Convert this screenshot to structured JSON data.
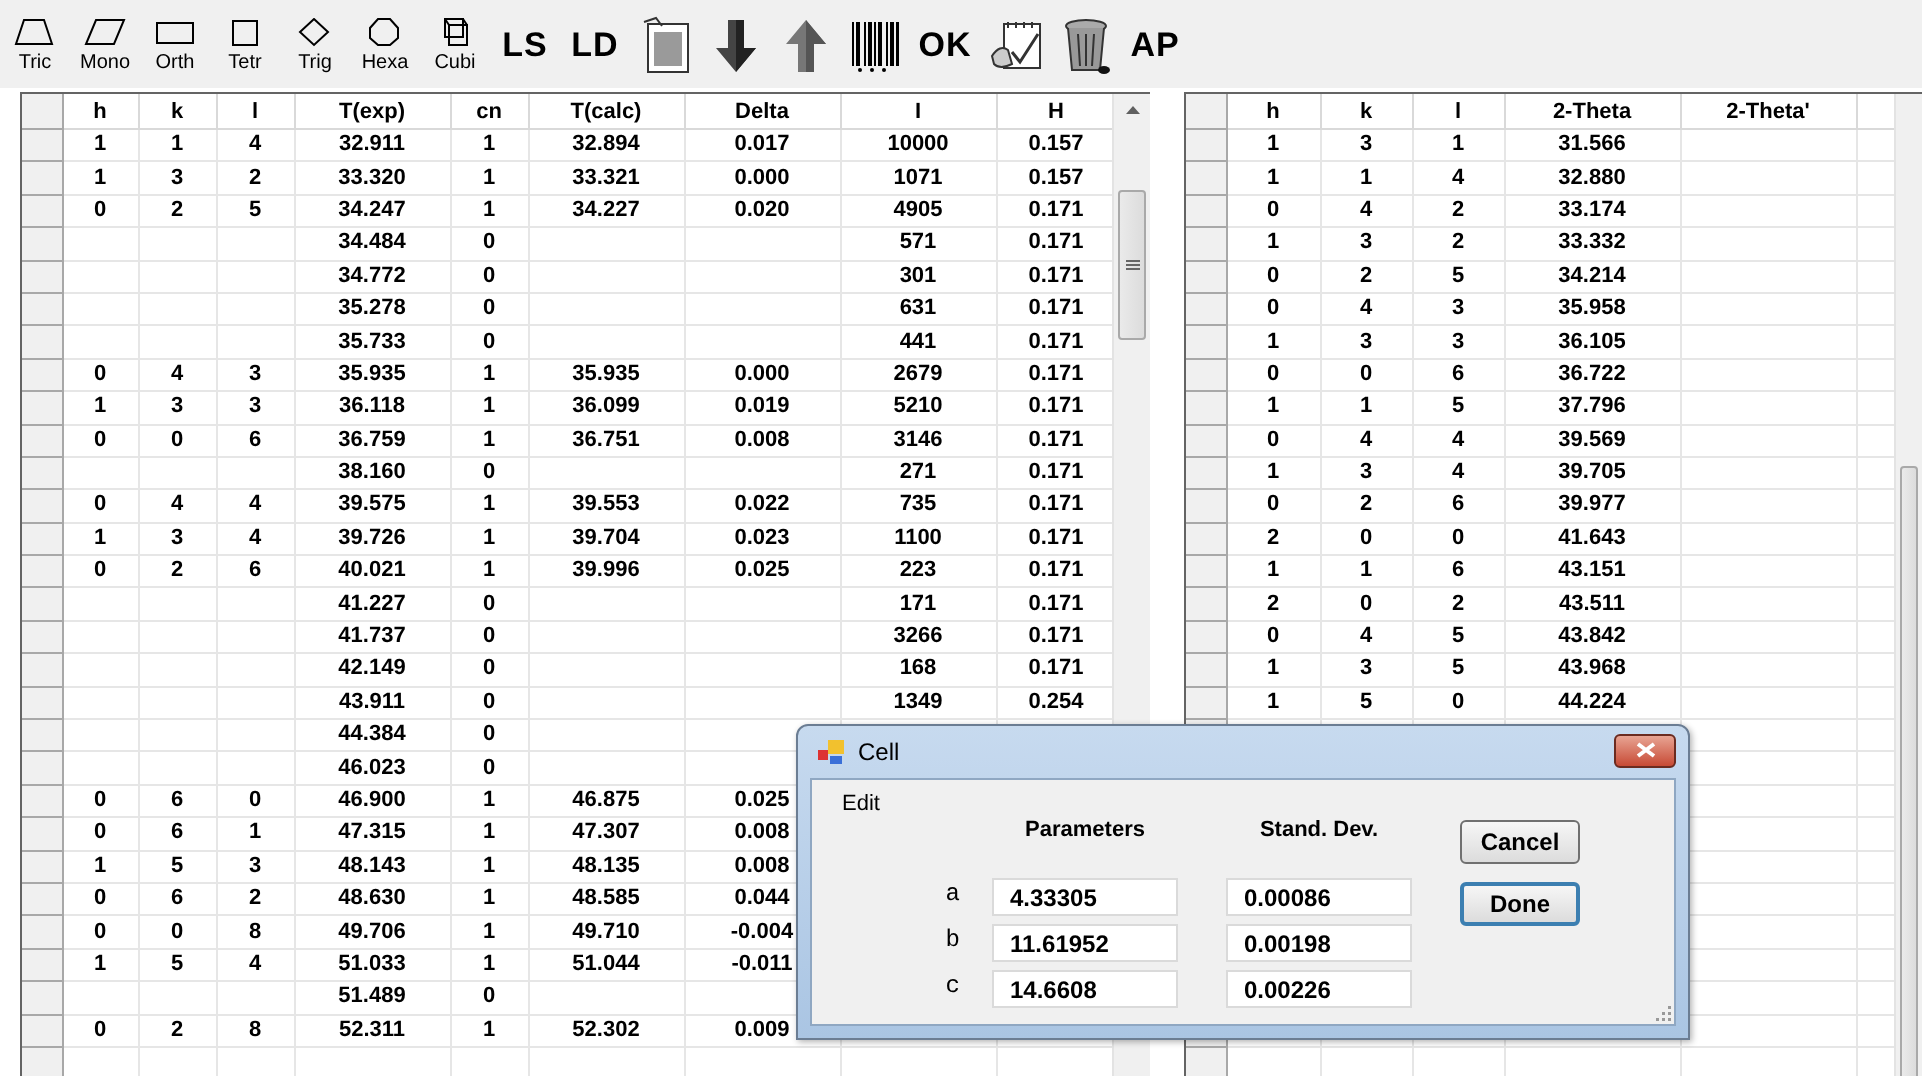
{
  "toolbar": {
    "items": [
      {
        "kind": "shape",
        "label": "Tric"
      },
      {
        "kind": "shape",
        "label": "Mono"
      },
      {
        "kind": "shape",
        "label": "Orth"
      },
      {
        "kind": "shape",
        "label": "Tetr"
      },
      {
        "kind": "shape",
        "label": "Trig"
      },
      {
        "kind": "shape",
        "label": "Hexa"
      },
      {
        "kind": "shape",
        "label": "Cubi"
      },
      {
        "kind": "text",
        "label": "LS"
      },
      {
        "kind": "text",
        "label": "LD"
      },
      {
        "kind": "icon"
      },
      {
        "kind": "icon"
      },
      {
        "kind": "icon"
      },
      {
        "kind": "icon"
      },
      {
        "kind": "text",
        "label": "OK"
      },
      {
        "kind": "icon"
      },
      {
        "kind": "icon"
      },
      {
        "kind": "text",
        "label": "AP"
      }
    ]
  },
  "left_table": {
    "columns": [
      "h",
      "k",
      "l",
      "T(exp)",
      "cn",
      "T(calc)",
      "Delta",
      "I",
      "H"
    ],
    "rows": [
      [
        "1",
        "1",
        "4",
        "32.911",
        "1",
        "32.894",
        "0.017",
        "10000",
        "0.157"
      ],
      [
        "1",
        "3",
        "2",
        "33.320",
        "1",
        "33.321",
        "0.000",
        "1071",
        "0.157"
      ],
      [
        "0",
        "2",
        "5",
        "34.247",
        "1",
        "34.227",
        "0.020",
        "4905",
        "0.171"
      ],
      [
        null,
        null,
        null,
        "34.484",
        "0",
        null,
        null,
        "571",
        "0.171"
      ],
      [
        null,
        null,
        null,
        "34.772",
        "0",
        null,
        null,
        "301",
        "0.171"
      ],
      [
        null,
        null,
        null,
        "35.278",
        "0",
        null,
        null,
        "631",
        "0.171"
      ],
      [
        null,
        null,
        null,
        "35.733",
        "0",
        null,
        null,
        "441",
        "0.171"
      ],
      [
        "0",
        "4",
        "3",
        "35.935",
        "1",
        "35.935",
        "0.000",
        "2679",
        "0.171"
      ],
      [
        "1",
        "3",
        "3",
        "36.118",
        "1",
        "36.099",
        "0.019",
        "5210",
        "0.171"
      ],
      [
        "0",
        "0",
        "6",
        "36.759",
        "1",
        "36.751",
        "0.008",
        "3146",
        "0.171"
      ],
      [
        null,
        null,
        null,
        "38.160",
        "0",
        null,
        null,
        "271",
        "0.171"
      ],
      [
        "0",
        "4",
        "4",
        "39.575",
        "1",
        "39.553",
        "0.022",
        "735",
        "0.171"
      ],
      [
        "1",
        "3",
        "4",
        "39.726",
        "1",
        "39.704",
        "0.023",
        "1100",
        "0.171"
      ],
      [
        "0",
        "2",
        "6",
        "40.021",
        "1",
        "39.996",
        "0.025",
        "223",
        "0.171"
      ],
      [
        null,
        null,
        null,
        "41.227",
        "0",
        null,
        null,
        "171",
        "0.171"
      ],
      [
        null,
        null,
        null,
        "41.737",
        "0",
        null,
        null,
        "3266",
        "0.171"
      ],
      [
        null,
        null,
        null,
        "42.149",
        "0",
        null,
        null,
        "168",
        "0.171"
      ],
      [
        null,
        null,
        null,
        "43.911",
        "0",
        null,
        null,
        "1349",
        "0.254"
      ],
      [
        null,
        null,
        null,
        "44.384",
        "0",
        null,
        null,
        null,
        null
      ],
      [
        null,
        null,
        null,
        "46.023",
        "0",
        null,
        null,
        null,
        null
      ],
      [
        "0",
        "6",
        "0",
        "46.900",
        "1",
        "46.875",
        "0.025",
        null,
        null
      ],
      [
        "0",
        "6",
        "1",
        "47.315",
        "1",
        "47.307",
        "0.008",
        null,
        null
      ],
      [
        "1",
        "5",
        "3",
        "48.143",
        "1",
        "48.135",
        "0.008",
        null,
        null
      ],
      [
        "0",
        "6",
        "2",
        "48.630",
        "1",
        "48.585",
        "0.044",
        null,
        null
      ],
      [
        "0",
        "0",
        "8",
        "49.706",
        "1",
        "49.710",
        "-0.004",
        null,
        null
      ],
      [
        "1",
        "5",
        "4",
        "51.033",
        "1",
        "51.044",
        "-0.011",
        null,
        null
      ],
      [
        null,
        null,
        null,
        "51.489",
        "0",
        null,
        null,
        null,
        null
      ],
      [
        "0",
        "2",
        "8",
        "52.311",
        "1",
        "52.302",
        "0.009",
        null,
        null
      ]
    ]
  },
  "right_table": {
    "columns": [
      "h",
      "k",
      "l",
      "2-Theta",
      "2-Theta'"
    ],
    "rows": [
      [
        "1",
        "3",
        "1",
        "31.566",
        null
      ],
      [
        "1",
        "1",
        "4",
        "32.880",
        null
      ],
      [
        "0",
        "4",
        "2",
        "33.174",
        null
      ],
      [
        "1",
        "3",
        "2",
        "33.332",
        null
      ],
      [
        "0",
        "2",
        "5",
        "34.214",
        null
      ],
      [
        "0",
        "4",
        "3",
        "35.958",
        null
      ],
      [
        "1",
        "3",
        "3",
        "36.105",
        null
      ],
      [
        "0",
        "0",
        "6",
        "36.722",
        null
      ],
      [
        "1",
        "1",
        "5",
        "37.796",
        null
      ],
      [
        "0",
        "4",
        "4",
        "39.569",
        null
      ],
      [
        "1",
        "3",
        "4",
        "39.705",
        null
      ],
      [
        "0",
        "2",
        "6",
        "39.977",
        null
      ],
      [
        "2",
        "0",
        "0",
        "41.643",
        null
      ],
      [
        "1",
        "1",
        "6",
        "43.151",
        null
      ],
      [
        "2",
        "0",
        "2",
        "43.511",
        null
      ],
      [
        "0",
        "4",
        "5",
        "43.842",
        null
      ],
      [
        "1",
        "3",
        "5",
        "43.968",
        null
      ],
      [
        "1",
        "5",
        "0",
        "44.224",
        null
      ]
    ]
  },
  "dialog": {
    "title": "Cell",
    "menu": [
      "Edit"
    ],
    "headers": [
      "Parameters",
      "Stand. Dev."
    ],
    "params": [
      {
        "label": "a",
        "value": "4.33305",
        "std_dev": "0.00086"
      },
      {
        "label": "b",
        "value": "11.61952",
        "std_dev": "0.00198"
      },
      {
        "label": "c",
        "value": "14.6608",
        "std_dev": "0.00226"
      }
    ],
    "buttons": [
      {
        "label": "Cancel",
        "default": false
      },
      {
        "label": "Done",
        "default": true
      }
    ]
  }
}
